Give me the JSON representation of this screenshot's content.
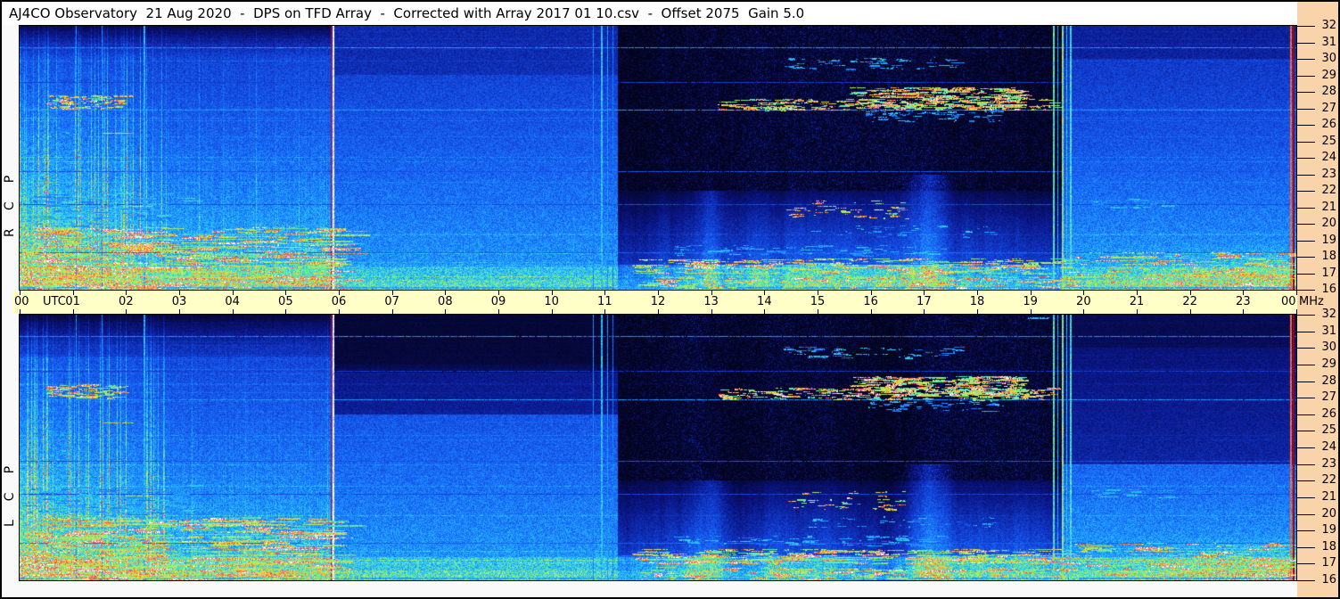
{
  "title_bar": {
    "title": "AJ4CO Observatory  21 Aug 2020  -  DPS on TFD Array  -  Corrected with Array 2017 01 10.csv  -  Offset 2075  Gain 5.0"
  },
  "axes": {
    "time": {
      "unit_label": "UTC",
      "tick_labels": [
        "00",
        "01",
        "02",
        "03",
        "04",
        "05",
        "06",
        "07",
        "08",
        "09",
        "10",
        "11",
        "12",
        "13",
        "14",
        "15",
        "16",
        "17",
        "18",
        "19",
        "20",
        "21",
        "22",
        "23",
        "00"
      ]
    },
    "freq": {
      "unit_label": "MHz",
      "tick_labels": [
        "32",
        "31",
        "30",
        "29",
        "28",
        "27",
        "26",
        "25",
        "24",
        "23",
        "22",
        "21",
        "20",
        "19",
        "18",
        "17",
        "16"
      ]
    }
  },
  "panels": [
    {
      "id": "rcp",
      "name": "RCP",
      "side_label": "RCP",
      "seed": 1013,
      "tweaks": {
        "mid_upper_dim": 0,
        "evening_upper_dim": 0
      }
    },
    {
      "id": "lcp",
      "name": "LCP",
      "side_label": "LCP",
      "seed": 2027,
      "tweaks": {
        "mid_upper_dim": 1,
        "evening_upper_dim": 1
      }
    }
  ],
  "colors": {
    "title_bg": "#ffffff",
    "axis_bg": "#ffffc8",
    "right_margin_bg": "#f9d4aa",
    "margin_bg": "#fafafa",
    "border": "#000000",
    "text": "#000000"
  },
  "chart_data": {
    "type": "heatmap",
    "title": "Dual-polarization dynamic power spectrum (radio spectrogram), RCP and LCP panels",
    "x": {
      "label": "UTC",
      "range": [
        0,
        24
      ],
      "unit": "hours"
    },
    "y": {
      "label": "MHz",
      "range": [
        16,
        32
      ],
      "direction": "32 at top, 16 at bottom"
    },
    "panels": [
      "RCP",
      "LCP"
    ],
    "colormap": "black-blue-cyan-green-yellow-red-magenta-white (intensity)",
    "features": {
      "horizontal_lines": [
        {
          "f": 30.7,
          "t0": 0,
          "t1": 24,
          "v": 0.5
        },
        {
          "f": 28.6,
          "t0": 0,
          "t1": 24,
          "v": 0.3
        },
        {
          "f": 26.9,
          "t0": 0,
          "t1": 24,
          "v": 0.52
        },
        {
          "f": 23.2,
          "t0": 0,
          "t1": 24,
          "v": 0.36
        },
        {
          "f": 21.2,
          "t0": 0,
          "t1": 24,
          "v": 0.33
        },
        {
          "f": 18.25,
          "t0": 0,
          "t1": 24,
          "v": 0.4
        },
        {
          "f": 16.15,
          "t0": 0,
          "t1": 24,
          "v": 0.55,
          "w": 2
        },
        {
          "f": 17.0,
          "t0": 21.2,
          "t1": 24,
          "v": 0.85,
          "w": 2
        },
        {
          "f": 17.95,
          "t0": 20.5,
          "t1": 24,
          "v": 0.7
        },
        {
          "f": 16.5,
          "t0": 20.2,
          "t1": 24,
          "v": 0.74
        },
        {
          "f": 25.5,
          "t0": 1.55,
          "t1": 2.15,
          "v": 0.84
        },
        {
          "f": 21.1,
          "t0": 2.0,
          "t1": 2.5,
          "v": 0.8
        },
        {
          "f": 31.85,
          "t0": 18.95,
          "t1": 19.35,
          "v": 0.6,
          "w": 2,
          "panel": "LCP"
        }
      ],
      "vertical_lines": [
        {
          "t": 5.885,
          "v": 1.0,
          "w": 2
        },
        {
          "t": 5.845,
          "rgb": [
            165,
            20,
            60
          ],
          "w": 1
        },
        {
          "t": 2.33,
          "v": 0.58,
          "w": 2
        },
        {
          "t": 1.05,
          "v": 0.5,
          "w": 1
        },
        {
          "t": 1.55,
          "v": 0.48,
          "w": 1
        },
        {
          "t": 10.78,
          "v": 0.48,
          "w": 1
        },
        {
          "t": 10.93,
          "v": 0.6,
          "w": 2
        },
        {
          "t": 11.04,
          "v": 0.52,
          "w": 1
        },
        {
          "t": 11.14,
          "v": 0.46,
          "w": 1
        },
        {
          "t": 19.42,
          "v": 0.7,
          "w": 2
        },
        {
          "t": 19.5,
          "v": 0.58,
          "w": 1
        },
        {
          "t": 19.6,
          "v": 0.76,
          "w": 2
        },
        {
          "t": 19.67,
          "v": 0.62,
          "w": 1
        },
        {
          "t": 19.74,
          "v": 0.68,
          "w": 2
        },
        {
          "t": 23.875,
          "v": 0.92,
          "w": 2
        },
        {
          "t": 23.94,
          "rgb": [
            135,
            12,
            30
          ],
          "w": 2
        }
      ],
      "burst_bands": [
        {
          "f0": 26.9,
          "f1": 27.6,
          "t0": 13.1,
          "t1": 19.4,
          "n": 240,
          "maxlen": 0.3
        },
        {
          "f0": 27.1,
          "f1": 28.3,
          "t0": 15.6,
          "t1": 18.8,
          "n": 300,
          "maxlen": 0.35
        },
        {
          "f0": 26.2,
          "f1": 26.9,
          "t0": 15.9,
          "t1": 18.5,
          "n": 70,
          "maxlen": 0.2,
          "palette": "cool"
        },
        {
          "f0": 29.4,
          "f1": 30.1,
          "t0": 14.3,
          "t1": 17.6,
          "n": 70,
          "maxlen": 0.25,
          "palette": "cool"
        },
        {
          "f0": 17.0,
          "f1": 17.9,
          "t0": 11.5,
          "t1": 19.7,
          "n": 280,
          "maxlen": 0.5
        },
        {
          "f0": 16.1,
          "f1": 16.8,
          "t0": 11.6,
          "t1": 19.9,
          "n": 200,
          "maxlen": 0.4
        },
        {
          "f0": 18.1,
          "f1": 18.7,
          "t0": 12.2,
          "t1": 17.3,
          "n": 90,
          "maxlen": 0.3,
          "palette": "cool"
        },
        {
          "f0": 20.3,
          "f1": 21.4,
          "t0": 14.4,
          "t1": 16.7,
          "n": 45,
          "maxlen": 0.25
        },
        {
          "f0": 19.2,
          "f1": 19.9,
          "t0": 14.8,
          "t1": 18.3,
          "n": 40,
          "maxlen": 0.2,
          "palette": "cool"
        },
        {
          "f0": 27.0,
          "f1": 27.8,
          "t0": 0.5,
          "t1": 1.9,
          "n": 110,
          "maxlen": 0.25
        },
        {
          "f0": 16.0,
          "f1": 19.8,
          "t0": 0.05,
          "t1": 5.8,
          "n": 520,
          "maxlen": 0.9
        },
        {
          "f0": 19.9,
          "f1": 21.9,
          "t0": 0.05,
          "t1": 3.2,
          "n": 130,
          "maxlen": 0.4,
          "palette": "cool"
        },
        {
          "f0": 22.0,
          "f1": 26.5,
          "t0": 0.05,
          "t1": 1.2,
          "n": 60,
          "maxlen": 0.1,
          "palette": "cool"
        },
        {
          "f0": 16.2,
          "f1": 18.3,
          "t0": 19.8,
          "t1": 23.9,
          "n": 160,
          "maxlen": 0.5
        },
        {
          "f0": 21.0,
          "f1": 21.5,
          "t0": 20.1,
          "t1": 21.5,
          "n": 30,
          "maxlen": 0.3,
          "palette": "cool"
        }
      ]
    }
  }
}
